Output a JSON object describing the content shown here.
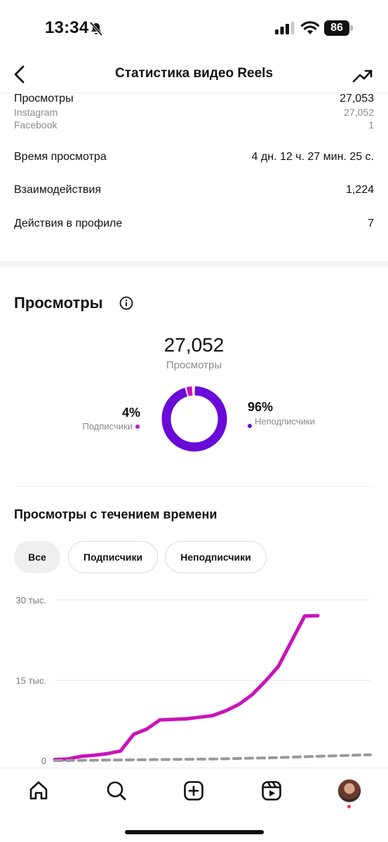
{
  "status_bar": {
    "time": "13:34",
    "battery": "86"
  },
  "header": {
    "title": "Статистика видео Reels"
  },
  "metrics": {
    "views": {
      "label": "Просмотры",
      "value": "27,053"
    },
    "instagram": {
      "label": "Instagram",
      "value": "27,052"
    },
    "facebook": {
      "label": "Facebook",
      "value": "1"
    },
    "watch_time": {
      "label": "Время просмотра",
      "value": "4 дн. 12 ч. 27 мин. 25 с."
    },
    "interactions": {
      "label": "Взаимодействия",
      "value": "1,224"
    },
    "profile_actions": {
      "label": "Действия в профиле",
      "value": "7"
    }
  },
  "views_section": {
    "title": "Просмотры",
    "total": "27,052",
    "total_label": "Просмотры",
    "followers": {
      "percent": "4%",
      "label": "Подписчики",
      "share": 0.04,
      "color": "#c913b9"
    },
    "non_followers": {
      "percent": "96%",
      "label": "Неподписчики",
      "share": 0.96,
      "color": "#6a0ad9"
    }
  },
  "chart_section": {
    "title": "Просмотры с течением времени",
    "filters": [
      "Все",
      "Подписчики",
      "Неподписчики"
    ],
    "active_filter": "Все"
  },
  "chart_data": {
    "type": "line",
    "yticks": [
      "30 тыс.",
      "15 тыс.",
      "0"
    ],
    "ylim": [
      0,
      30000
    ],
    "grid": true,
    "series": [
      {
        "color": "#c913b9",
        "style": "solid",
        "x": [
          0,
          1,
          2,
          3,
          4,
          5,
          6,
          7,
          8,
          9,
          10,
          11,
          12,
          13,
          14,
          15,
          16,
          17,
          18,
          19,
          20
        ],
        "values": [
          200,
          300,
          800,
          1000,
          1300,
          1800,
          4900,
          5900,
          7600,
          7700,
          7800,
          8100,
          8400,
          9300,
          10500,
          12300,
          14800,
          17600,
          22300,
          27000,
          27050
        ]
      },
      {
        "color": "#999999",
        "style": "dashed",
        "x": [
          0,
          4,
          8,
          12,
          16,
          20,
          24
        ],
        "values": [
          0,
          100,
          200,
          300,
          500,
          800,
          1100
        ]
      }
    ]
  },
  "nav": {
    "items": [
      "home-icon",
      "search-icon",
      "create-icon",
      "reels-icon",
      "profile-avatar"
    ]
  }
}
